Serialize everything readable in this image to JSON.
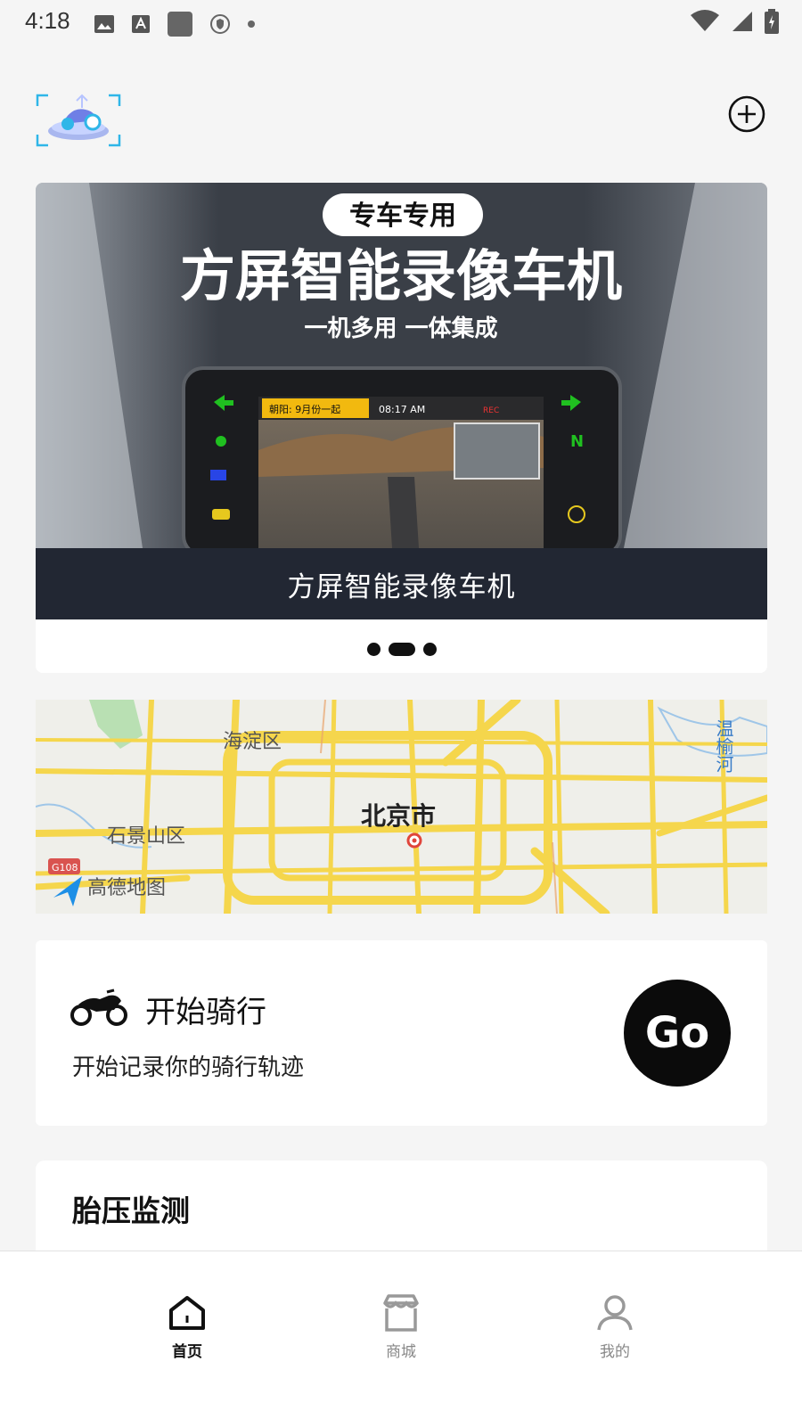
{
  "status_bar": {
    "time": "4:18"
  },
  "banner": {
    "badge": "专车专用",
    "headline": "方屏智能录像车机",
    "tagline": "一机多用 一体集成",
    "screen_info": "朝阳: 9月份一起",
    "screen_time": "08:17 AM",
    "screen_rec": "REC",
    "caption": "方屏智能录像车机",
    "active_dot": 1
  },
  "map": {
    "labels": {
      "haidian": "海淀区",
      "beijing": "北京市",
      "shijingshan": "石景山区",
      "wenyu": "温榆河",
      "road": "G108"
    },
    "attribution": "高德地图"
  },
  "ride": {
    "title": "开始骑行",
    "subtitle": "开始记录你的骑行轨迹",
    "go_label": "Go"
  },
  "tire": {
    "title": "胎压监测"
  },
  "nav": {
    "items": [
      {
        "label": "首页"
      },
      {
        "label": "商城"
      },
      {
        "label": "我的"
      }
    ]
  },
  "colors": {
    "accent": "#000000",
    "banner_bar": "#222733",
    "map_road": "#f5d64c",
    "nav_inactive": "#888888"
  }
}
